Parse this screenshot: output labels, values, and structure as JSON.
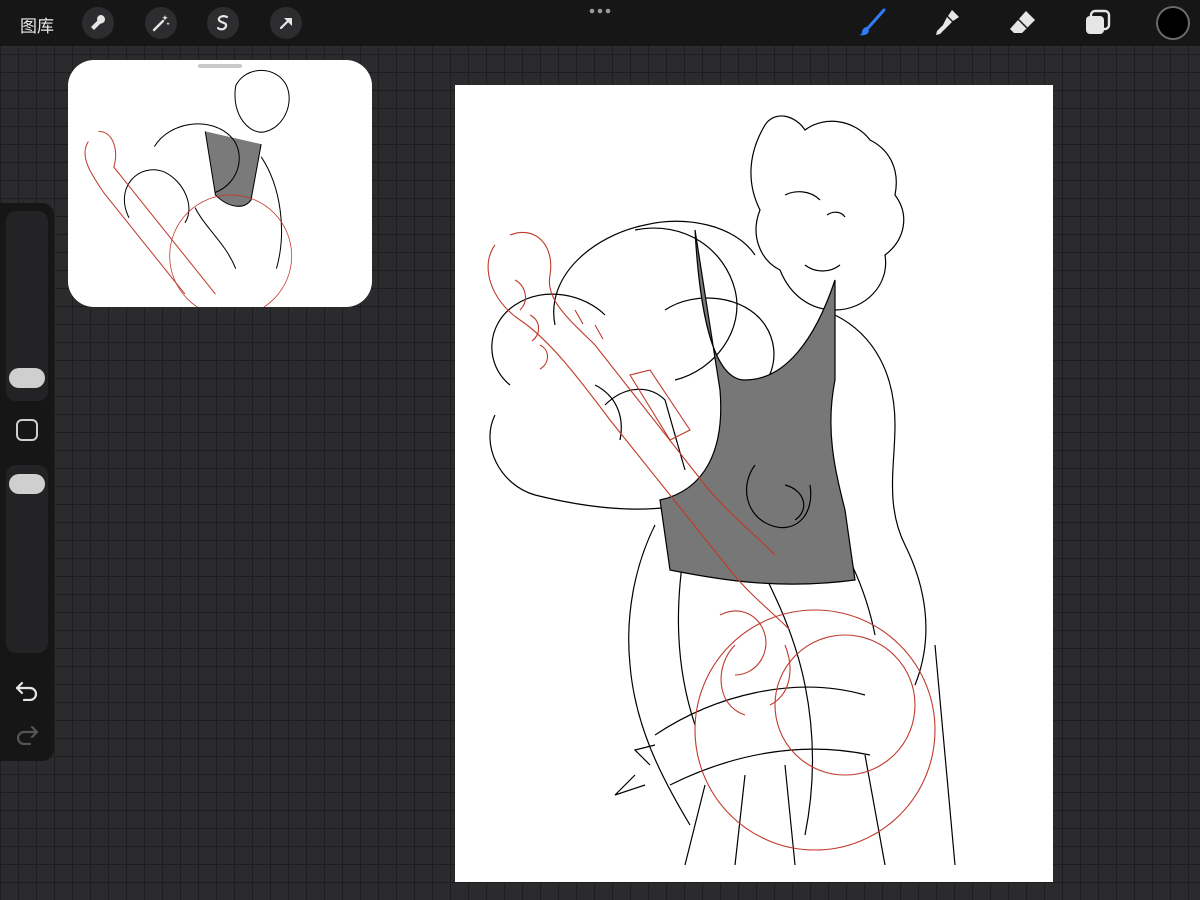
{
  "toolbar": {
    "gallery_label": "图库",
    "left_tools": [
      "wrench-icon",
      "magic-wand-icon",
      "selection-icon",
      "transform-arrow-icon"
    ],
    "right_tools": [
      "brush-icon",
      "smudge-icon",
      "eraser-icon",
      "layers-icon"
    ],
    "active_tool": "brush-icon",
    "accent_color": "#2f7cf6",
    "current_color": "#000000"
  },
  "sidebar": {
    "controls": [
      "brush-size-slider",
      "modify-button",
      "opacity-slider",
      "undo-icon",
      "redo-icon"
    ]
  },
  "canvas": {
    "line_colors": {
      "sketch": "#000000",
      "guide": "#c0392b",
      "fill": "#777777"
    }
  }
}
